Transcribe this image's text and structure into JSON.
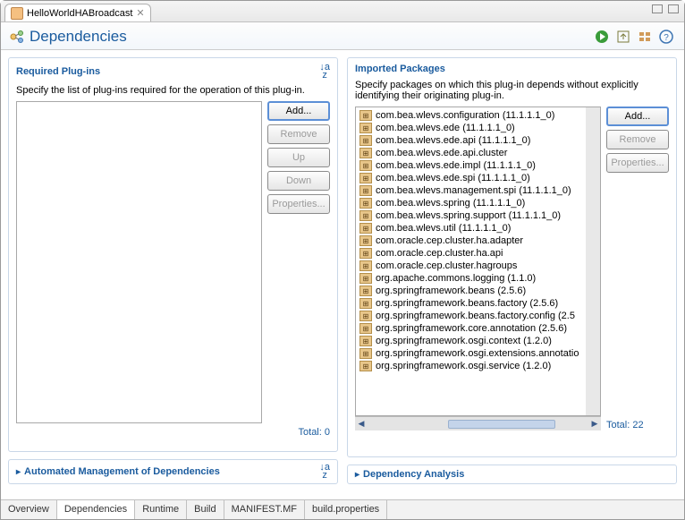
{
  "tab": {
    "title": "HelloWorldHABroadcast"
  },
  "page": {
    "title": "Dependencies"
  },
  "required": {
    "section_title": "Required Plug-ins",
    "description": "Specify the list of plug-ins required for the operation of this plug-in.",
    "buttons": {
      "add": "Add...",
      "remove": "Remove",
      "up": "Up",
      "down": "Down",
      "properties": "Properties..."
    },
    "total_label": "Total:",
    "total": 0
  },
  "imported": {
    "section_title": "Imported Packages",
    "description": "Specify packages on which this plug-in depends without explicitly identifying their originating plug-in.",
    "buttons": {
      "add": "Add...",
      "remove": "Remove",
      "properties": "Properties..."
    },
    "packages": [
      "com.bea.wlevs.configuration (11.1.1.1_0)",
      "com.bea.wlevs.ede (11.1.1.1_0)",
      "com.bea.wlevs.ede.api (11.1.1.1_0)",
      "com.bea.wlevs.ede.api.cluster",
      "com.bea.wlevs.ede.impl (11.1.1.1_0)",
      "com.bea.wlevs.ede.spi (11.1.1.1_0)",
      "com.bea.wlevs.management.spi (11.1.1.1_0)",
      "com.bea.wlevs.spring (11.1.1.1_0)",
      "com.bea.wlevs.spring.support (11.1.1.1_0)",
      "com.bea.wlevs.util (11.1.1.1_0)",
      "com.oracle.cep.cluster.ha.adapter",
      "com.oracle.cep.cluster.ha.api",
      "com.oracle.cep.cluster.hagroups",
      "org.apache.commons.logging (1.1.0)",
      "org.springframework.beans (2.5.6)",
      "org.springframework.beans.factory (2.5.6)",
      "org.springframework.beans.factory.config (2.5",
      "org.springframework.core.annotation (2.5.6)",
      "org.springframework.osgi.context (1.2.0)",
      "org.springframework.osgi.extensions.annotatio",
      "org.springframework.osgi.service (1.2.0)"
    ],
    "total_label": "Total:",
    "total": 22
  },
  "automated": {
    "title": "Automated Management of Dependencies"
  },
  "analysis": {
    "title": "Dependency Analysis"
  },
  "bottom_tabs": [
    "Overview",
    "Dependencies",
    "Runtime",
    "Build",
    "MANIFEST.MF",
    "build.properties"
  ]
}
